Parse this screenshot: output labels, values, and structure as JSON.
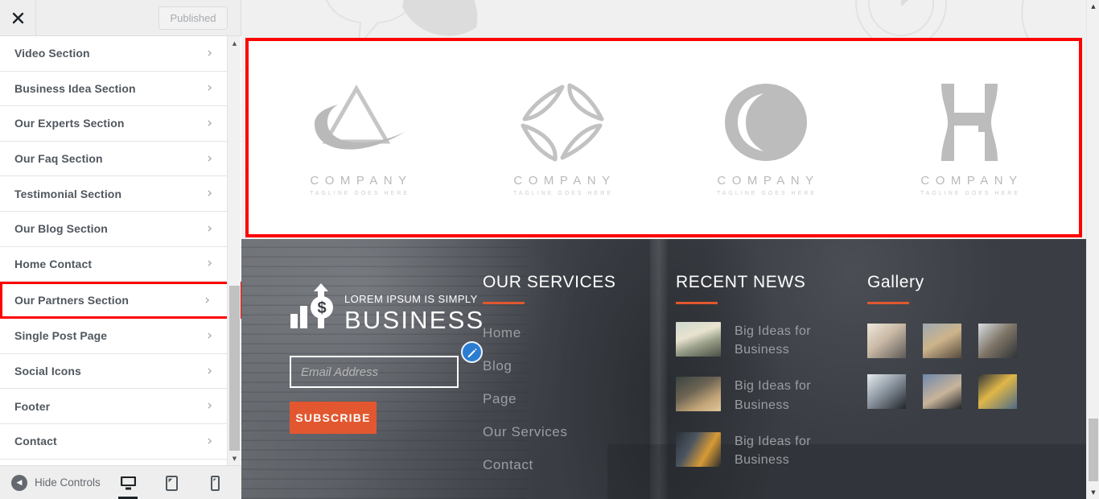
{
  "sidebar": {
    "close_icon": "close-icon",
    "published_label": "Published",
    "items": [
      {
        "label": "Video Section",
        "chevron": "›"
      },
      {
        "label": "Business Idea Section",
        "chevron": "›"
      },
      {
        "label": "Our Experts Section",
        "chevron": "›"
      },
      {
        "label": "Our Faq Section",
        "chevron": "›"
      },
      {
        "label": "Testimonial Section",
        "chevron": "›"
      },
      {
        "label": "Our Blog Section",
        "chevron": "›"
      },
      {
        "label": "Home Contact",
        "chevron": "›"
      },
      {
        "label": "Our Partners Section",
        "chevron": "›"
      },
      {
        "label": "Single Post Page",
        "chevron": "›"
      },
      {
        "label": "Social Icons",
        "chevron": "›"
      },
      {
        "label": "Footer",
        "chevron": "›"
      },
      {
        "label": "Contact",
        "chevron": "›"
      }
    ],
    "highlighted_item": "Our Partners Section",
    "footer": {
      "hide_controls_label": "Hide Controls",
      "back_arrow": "◀",
      "devices": [
        {
          "name": "desktop",
          "active": true
        },
        {
          "name": "tablet",
          "active": false
        },
        {
          "name": "mobile",
          "active": false
        }
      ]
    },
    "scroll": {
      "up_arrow": "▲",
      "down_arrow": "▼"
    }
  },
  "preview": {
    "highlight_color": "#ff0000",
    "partners": {
      "items": [
        {
          "mark": "logo-triangle-swoosh-icon",
          "name": "COMPANY",
          "tagline": "TAGLINE GOES HERE"
        },
        {
          "mark": "logo-diamond-leaves-icon",
          "name": "COMPANY",
          "tagline": "TAGLINE GOES HERE"
        },
        {
          "mark": "logo-circle-o-icon",
          "name": "COMPANY",
          "tagline": "TAGLINE GOES HERE"
        },
        {
          "mark": "logo-letter-h-icon",
          "name": "COMPANY",
          "tagline": "TAGLINE GOES HERE"
        }
      ]
    },
    "footer": {
      "accent_color": "#e2572f",
      "background_color": "#3c4046",
      "brand": {
        "small_text": "LOREM IPSUM IS SIMPLY",
        "big_text": "BUSINESS",
        "logo_icon": "chart-arrow-dollar-icon"
      },
      "newsletter": {
        "placeholder": "Email Address",
        "value": "",
        "button_label": "SUBSCRIBE"
      },
      "services": {
        "heading": "OUR SERVICES",
        "links": [
          "Home",
          "Blog",
          "Page",
          "Our Services",
          "Contact"
        ],
        "edit_pin_icon": "pencil-edit-icon"
      },
      "recent_news": {
        "heading": "RECENT NEWS",
        "items": [
          {
            "title": "Big Ideas for Business"
          },
          {
            "title": "Big Ideas for Business"
          },
          {
            "title": "Big Ideas for Business"
          }
        ]
      },
      "gallery": {
        "heading": "Gallery",
        "cells": [
          "gallery-thumb-1",
          "gallery-thumb-2",
          "gallery-thumb-3",
          "gallery-thumb-4",
          "gallery-thumb-5",
          "gallery-thumb-6"
        ]
      }
    },
    "scroll": {
      "up_arrow": "▲",
      "down_arrow": "▼"
    }
  }
}
